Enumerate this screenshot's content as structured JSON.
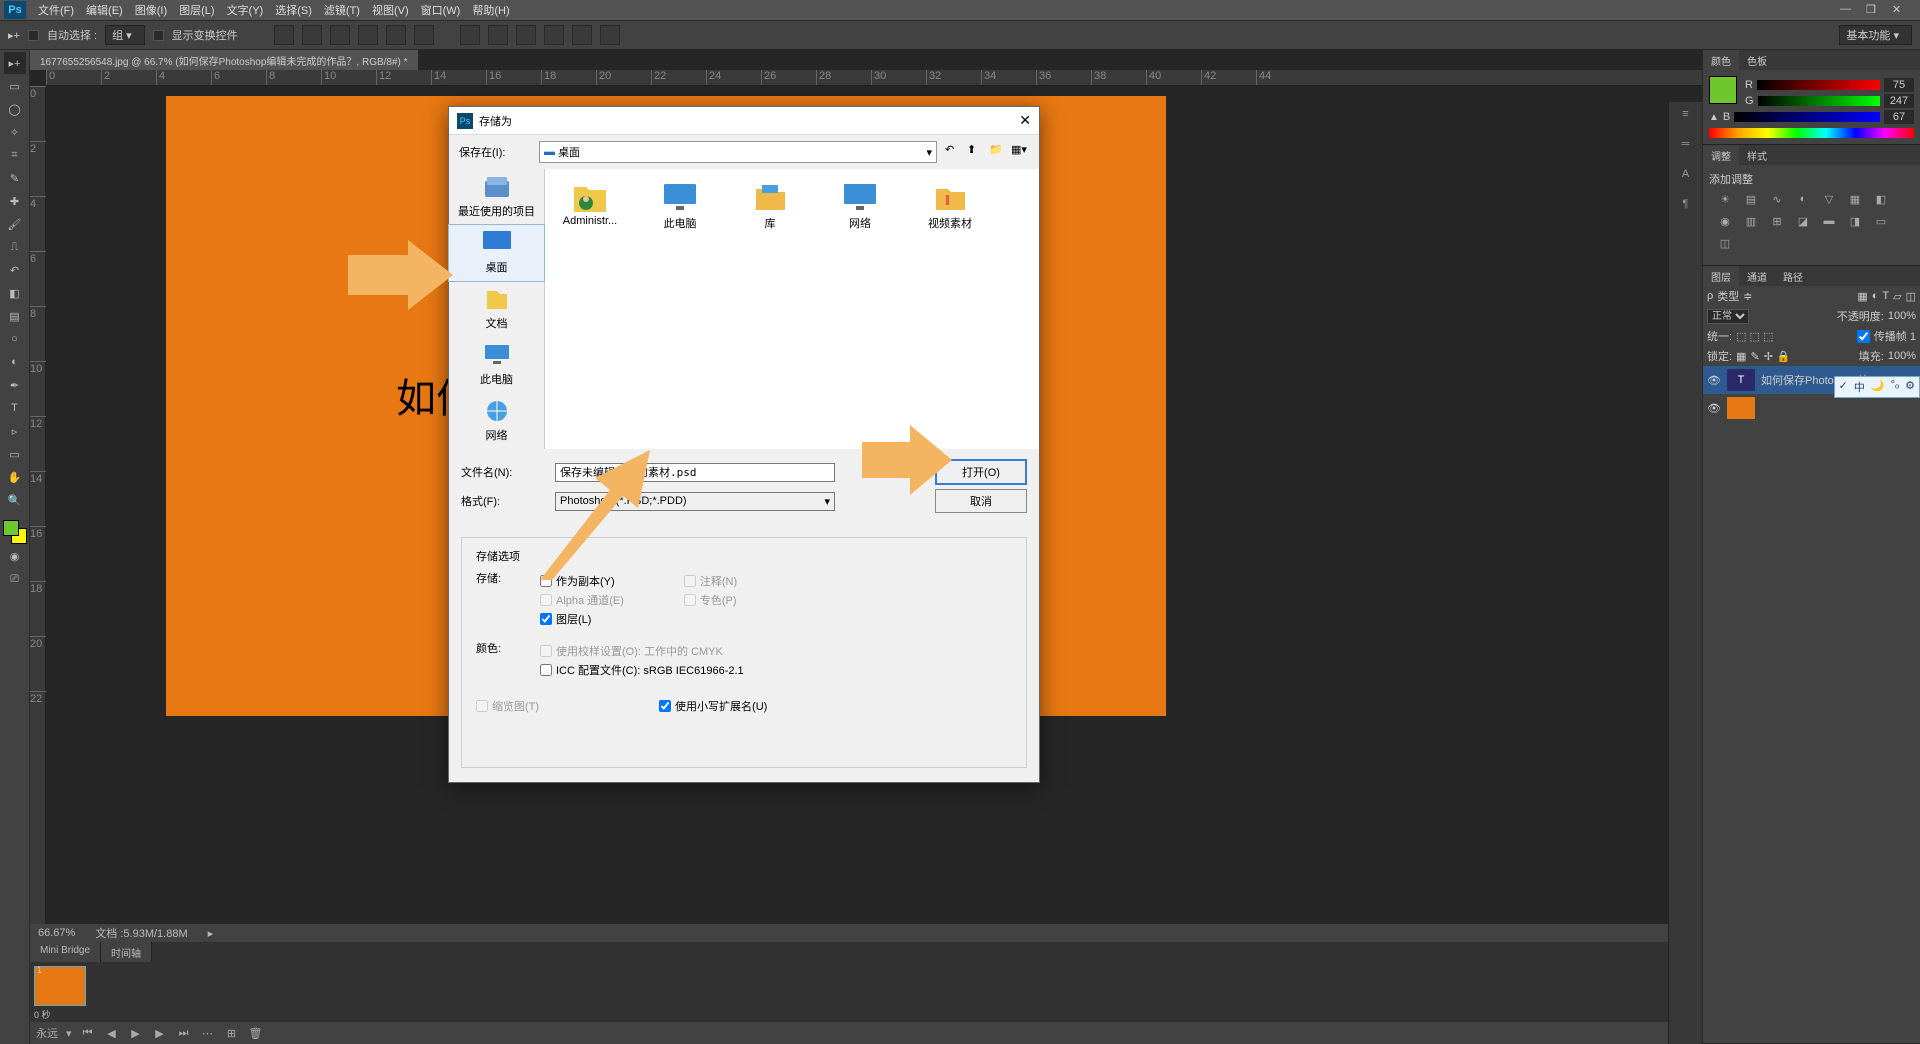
{
  "menubar": {
    "items": [
      "文件(F)",
      "编辑(E)",
      "图像(I)",
      "图层(L)",
      "文字(Y)",
      "选择(S)",
      "滤镜(T)",
      "视图(V)",
      "窗口(W)",
      "帮助(H)"
    ]
  },
  "optbar": {
    "auto_select": "自动选择 :",
    "group": "组",
    "show_transform": "显示变换控件",
    "workspace": "基本功能"
  },
  "document": {
    "tab": "1677655256548.jpg @ 66.7% (如何保存Photoshop编辑未完成的作品？, RGB/8#) *",
    "canvas_text": "如何",
    "zoom": "66.67%",
    "docinfo": "文档 :5.93M/1.88M"
  },
  "bottom_tabs": [
    "Mini Bridge",
    "时间轴"
  ],
  "timeline": {
    "time": "0 秒",
    "perm": "永远"
  },
  "color_panel": {
    "tabs": [
      "颜色",
      "色板"
    ],
    "r_label": "R",
    "r_val": "75",
    "g_label": "G",
    "g_val": "247",
    "b_label": "B",
    "b_val": "67"
  },
  "adjust_panel": {
    "tabs": [
      "调整",
      "样式"
    ],
    "title": "添加调整"
  },
  "layers_panel": {
    "tabs": [
      "图层",
      "通道",
      "路径"
    ],
    "kind": "类型",
    "blend": "正常",
    "opacity_label": "不透明度:",
    "opacity_val": "100%",
    "lock_label": "锁定:",
    "unify_label": "统一:",
    "propagate": "传播帧 1",
    "fill_label": "填充:",
    "fill_val": "100%",
    "layer1": "如何保存Photoshop编",
    "layer2": "",
    "badge": "中"
  },
  "dialog": {
    "title": "存储为",
    "save_in": "保存在(I):",
    "save_in_val": "桌面",
    "left_items": [
      "最近使用的项目",
      "桌面",
      "文档",
      "此电脑",
      "网络"
    ],
    "files": [
      "Administr...",
      "此电脑",
      "库",
      "网络",
      "视频素材"
    ],
    "filename_label": "文件名(N):",
    "filename_val": "保存未编辑完成的素材.psd",
    "format_label": "格式(F):",
    "format_val": "Photoshop (*.PSD;*.PDD)",
    "open_btn": "打开(O)",
    "cancel_btn": "取消",
    "opts_header": "存储选项",
    "opts_save": "存储:",
    "as_copy": "作为副本(Y)",
    "alpha": "Alpha 通道(E)",
    "layers": "图层(L)",
    "notes": "注释(N)",
    "spot": "专色(P)",
    "color_header": "颜色:",
    "proof": "使用校样设置(O): 工作中的 CMYK",
    "icc": "ICC 配置文件(C): sRGB IEC61966-2.1",
    "thumbnail": "缩览图(T)",
    "lc_ext": "使用小写扩展名(U)"
  },
  "ruler_ticks_h": [
    0,
    2,
    4,
    6,
    8,
    10,
    12,
    14,
    16,
    18,
    20,
    22,
    24,
    26,
    28,
    30,
    32,
    34,
    36,
    38,
    40,
    42,
    44
  ],
  "ruler_ticks_v": [
    0,
    2,
    4,
    6,
    8,
    10,
    12,
    14,
    16,
    18,
    20,
    22
  ]
}
